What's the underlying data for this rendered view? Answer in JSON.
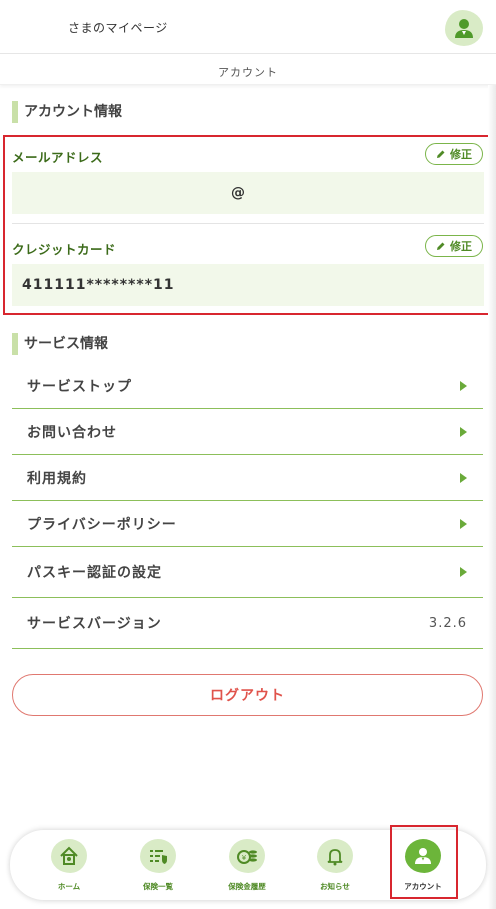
{
  "header": {
    "mypage_title": "さまのマイページ",
    "avatar_icon": "user-avatar-icon"
  },
  "subbar": {
    "title": "アカウント"
  },
  "account_section": {
    "heading": "アカウント情報",
    "email": {
      "label": "メールアドレス",
      "edit_label": "修正",
      "value": "@"
    },
    "card": {
      "label": "クレジットカード",
      "edit_label": "修正",
      "value": "411111********11"
    }
  },
  "service_section": {
    "heading": "サービス情報",
    "items": [
      {
        "label": "サービストップ"
      },
      {
        "label": "お問い合わせ"
      },
      {
        "label": "利用規約"
      },
      {
        "label": "プライバシーポリシー"
      },
      {
        "label": "パスキー認証の設定"
      }
    ],
    "version": {
      "label": "サービスバージョン",
      "value": "3.2.6"
    }
  },
  "logout_label": "ログアウト",
  "tabbar": {
    "tabs": [
      {
        "label": "ホーム",
        "icon": "home-icon"
      },
      {
        "label": "保険一覧",
        "icon": "insurance-list-icon"
      },
      {
        "label": "保険金履歴",
        "icon": "claim-history-icon"
      },
      {
        "label": "お知らせ",
        "icon": "bell-icon"
      },
      {
        "label": "アカウント",
        "icon": "account-icon",
        "active": true
      }
    ]
  },
  "colors": {
    "accent": "#6cb53a",
    "accent_light": "#d9ebc6",
    "highlight": "#d8262f",
    "logout": "#e0534b"
  }
}
